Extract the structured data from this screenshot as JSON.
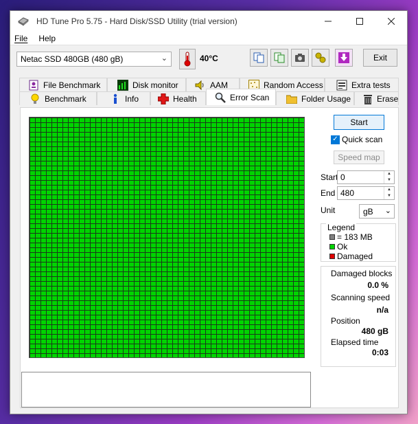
{
  "window": {
    "title": "HD Tune Pro 5.75 - Hard Disk/SSD Utility (trial version)"
  },
  "menu": {
    "file": "File",
    "help": "Help"
  },
  "toolbar": {
    "drive": "Netac SSD 480GB (480 gB)",
    "temperature": "40°C",
    "exit_label": "Exit"
  },
  "tabs": {
    "row1": [
      "File Benchmark",
      "Disk monitor",
      "AAM",
      "Random Access",
      "Extra tests"
    ],
    "row2": [
      "Benchmark",
      "Info",
      "Health",
      "Error Scan",
      "Folder Usage",
      "Erase"
    ],
    "active": "Error Scan"
  },
  "error_scan": {
    "start_button": "Start",
    "quick_scan_label": "Quick scan",
    "quick_scan_checked": true,
    "speed_map_button": "Speed map",
    "start_label": "Start",
    "start_value": "0",
    "end_label": "End",
    "end_value": "480",
    "unit_label": "Unit",
    "unit_value": "gB",
    "legend": {
      "title": "Legend",
      "block_size": "= 183 MB",
      "ok": "Ok",
      "damaged": "Damaged"
    },
    "stats": {
      "damaged_blocks_label": "Damaged blocks",
      "damaged_blocks_value": "0.0 %",
      "scanning_speed_label": "Scanning speed",
      "scanning_speed_value": "n/a",
      "position_label": "Position",
      "position_value": "480 gB",
      "elapsed_label": "Elapsed time",
      "elapsed_value": "0:03"
    },
    "block_status": "all ok"
  },
  "colors": {
    "ok": "#00d400",
    "damaged": "#e00000",
    "block": "#808080",
    "accent": "#0078d7"
  }
}
